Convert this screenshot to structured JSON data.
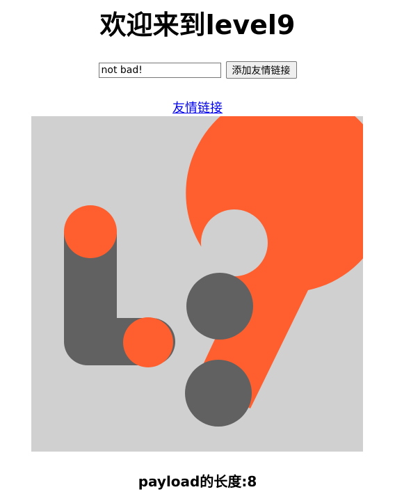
{
  "header": {
    "title": "欢迎来到level9"
  },
  "form": {
    "input_value": "not bad!",
    "submit_label": "添加友情链接"
  },
  "friend_link": {
    "label": "友情链接"
  },
  "logo": {
    "icon": "level9-logo-icon",
    "colors": {
      "background": "#d0d0d0",
      "orange": "#ff5f2e",
      "gray": "#616161"
    }
  },
  "footer": {
    "payload_length": "payload的长度:8"
  }
}
